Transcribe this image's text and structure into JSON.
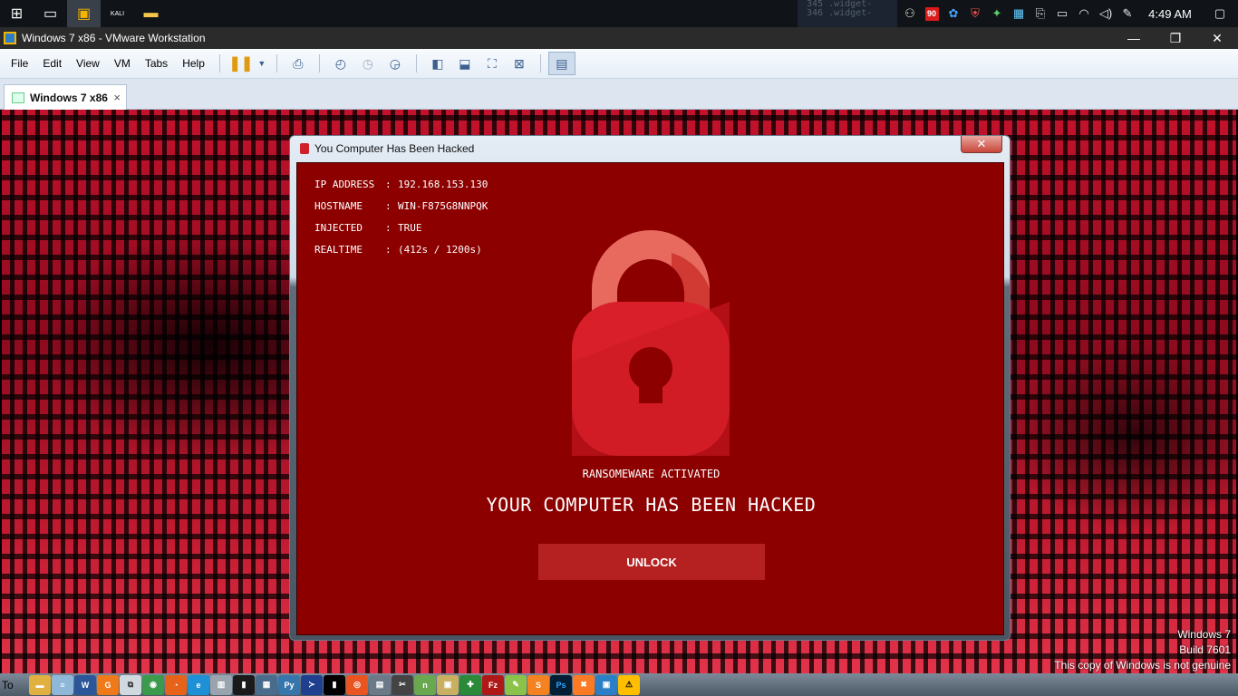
{
  "host_taskbar": {
    "clock": "4:49 AM",
    "notification_badge": "90",
    "buttons": [
      {
        "name": "windows-start-icon",
        "glyph": "⊞"
      },
      {
        "name": "task-view-icon",
        "glyph": "▭"
      },
      {
        "name": "vmware-taskbar-icon",
        "glyph": "▣"
      },
      {
        "name": "kali-taskbar-icon",
        "glyph": "KALI"
      },
      {
        "name": "file-explorer-icon",
        "glyph": "▬"
      }
    ],
    "code_lines": [
      "345  .widget-",
      "346  .widget-"
    ]
  },
  "vmware": {
    "window_title": "Windows 7 x86 - VMware Workstation",
    "menus": [
      "File",
      "Edit",
      "View",
      "VM",
      "Tabs",
      "Help"
    ],
    "tab_label": "Windows 7 x86",
    "close_glyph": "×",
    "ctrl_minimize": "—",
    "ctrl_restore": "❐",
    "ctrl_close": "✕"
  },
  "dialog": {
    "title": "You Computer Has Been Hacked",
    "close_glyph": "✕",
    "info": [
      {
        "key": "IP ADDRESS",
        "value": "192.168.153.130"
      },
      {
        "key": "HOSTNAME",
        "value": "WIN-F875G8NNPQK"
      },
      {
        "key": "INJECTED",
        "value": "TRUE"
      },
      {
        "key": "REALTIME",
        "value": "(412s / 1200s)"
      }
    ],
    "separator": ":",
    "status_subtitle": "RANSOMEWARE ACTIVATED",
    "headline": "YOUR COMPUTER HAS BEEN HACKED",
    "unlock_label": "UNLOCK"
  },
  "guest": {
    "genuine_line1": "Windows 7",
    "genuine_line2": "Build 7601",
    "genuine_line3": "This copy of Windows is not genuine",
    "taskbar_label": "To"
  },
  "colors": {
    "dialog_background": "#8c0000",
    "unlock_button": "#b52020",
    "lock_body": "#d9202a"
  }
}
